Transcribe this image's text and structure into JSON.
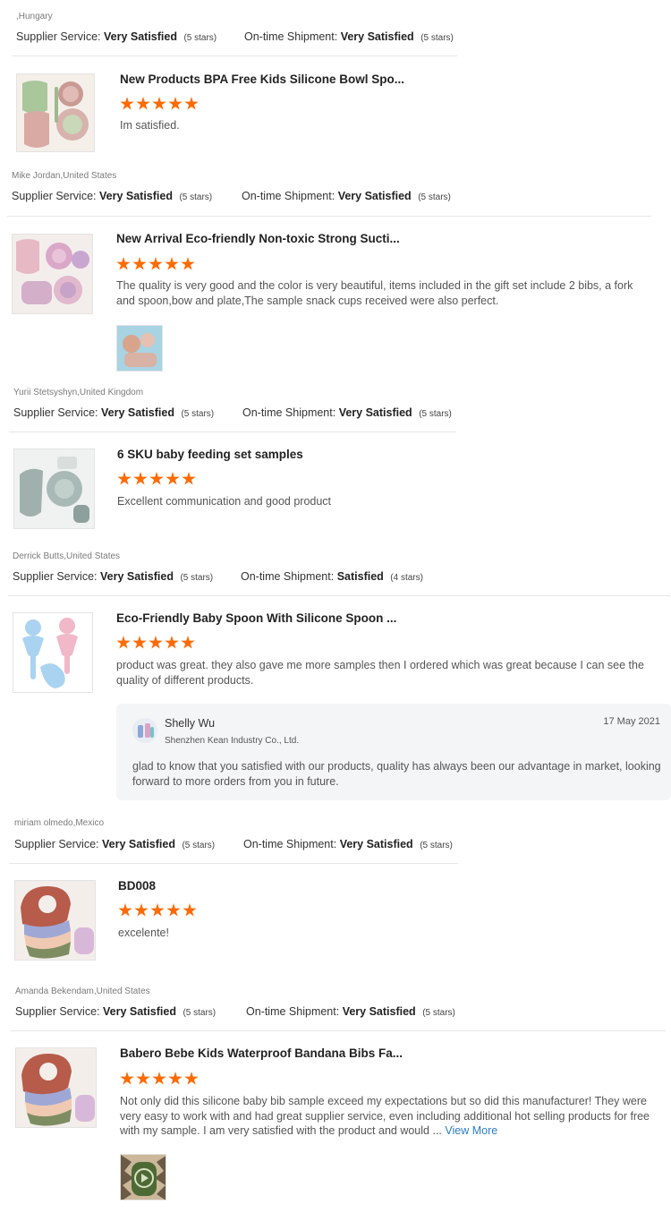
{
  "header": {
    "location": ",Hungary",
    "supplier_label": "Supplier Service:",
    "supplier_value": "Very Satisfied",
    "supplier_stars": "(5 stars)",
    "shipment_label": "On-time Shipment:",
    "shipment_value": "Very Satisfied",
    "shipment_stars": "(5 stars)"
  },
  "reviews": [
    {
      "title": "New Products BPA Free Kids Silicone Bowl Spo...",
      "rating": 5,
      "text": "Im satisfied.",
      "reviewer": "Mike Jordan,United States",
      "supplier_label": "Supplier Service:",
      "supplier_value": "Very Satisfied",
      "supplier_stars": "(5 stars)",
      "shipment_label": "On-time Shipment:",
      "shipment_value": "Very Satisfied",
      "shipment_stars": "(5 stars)"
    },
    {
      "title": "New Arrival Eco-friendly Non-toxic Strong Sucti...",
      "rating": 5,
      "text": "The quality is very good and the color is very beautiful, items included in the gift set include 2 bibs, a fork and spoon,bow and plate,The sample snack cups received were also perfect.",
      "reviewer": "Yurii Stetsyshyn,United Kingdom",
      "supplier_label": "Supplier Service:",
      "supplier_value": "Very Satisfied",
      "supplier_stars": "(5 stars)",
      "shipment_label": "On-time Shipment:",
      "shipment_value": "Very Satisfied",
      "shipment_stars": "(5 stars)"
    },
    {
      "title": "6 SKU baby feeding set samples",
      "rating": 5,
      "text": "Excellent communication and good product",
      "reviewer": "Derrick Butts,United States",
      "supplier_label": "Supplier Service:",
      "supplier_value": "Very Satisfied",
      "supplier_stars": "(5 stars)",
      "shipment_label": "On-time Shipment:",
      "shipment_value": "Satisfied",
      "shipment_stars": "(4 stars)"
    },
    {
      "title": "Eco-Friendly Baby Spoon With Silicone Spoon ...",
      "rating": 5,
      "text": "product was great. they also gave me more samples then I ordered which was great because I can see the quality of different products.",
      "reply": {
        "name": "Shelly Wu",
        "company": "Shenzhen Kean Industry Co., Ltd.",
        "date": "17 May 2021",
        "text": "glad to know that you satisfied with our products, quality has always been our advantage in market, looking forward to more orders from you in future."
      },
      "reviewer": "miriam olmedo,Mexico",
      "supplier_label": "Supplier Service:",
      "supplier_value": "Very Satisfied",
      "supplier_stars": "(5 stars)",
      "shipment_label": "On-time Shipment:",
      "shipment_value": "Very Satisfied",
      "shipment_stars": "(5 stars)"
    },
    {
      "title": "BD008",
      "rating": 5,
      "text": "excelente!",
      "reviewer": "Amanda Bekendam,United States",
      "supplier_label": "Supplier Service:",
      "supplier_value": "Very Satisfied",
      "supplier_stars": "(5 stars)",
      "shipment_label": "On-time Shipment:",
      "shipment_value": "Very Satisfied",
      "shipment_stars": "(5 stars)"
    },
    {
      "title": "Babero Bebe Kids Waterproof Bandana Bibs Fa...",
      "rating": 5,
      "text": "Not only did this silicone baby bib sample exceed my expectations but so did this manufacturer! They were very easy to work with and had great supplier service, even including additional hot selling products for free with my sample. I am very satisfied with the product and would ...",
      "view_more": "View More"
    }
  ],
  "colors": {
    "star": "#ff6a00",
    "link": "#2a7cc7",
    "reply_bg": "#f4f5f7"
  }
}
